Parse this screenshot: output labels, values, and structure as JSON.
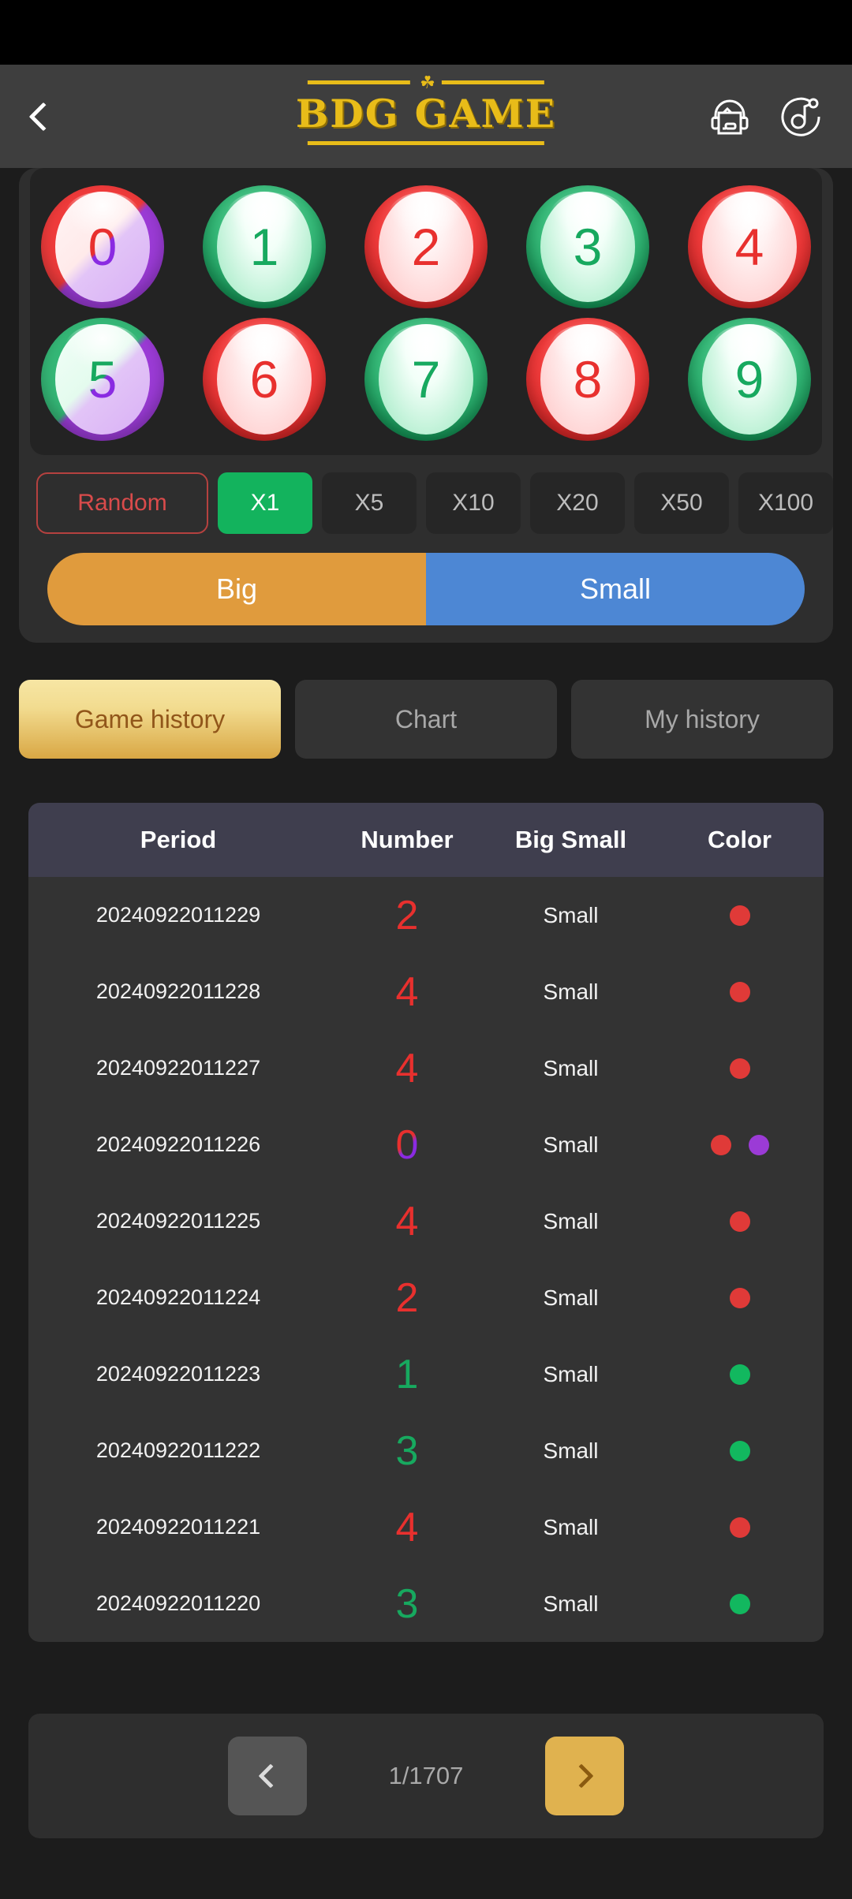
{
  "header": {
    "back_icon": "chevron-left-icon",
    "title": "BDG GAME",
    "ornament": "☘",
    "support_icon": "headset-icon",
    "sound_icon": "music-note-icon"
  },
  "bet_panel": {
    "balls": [
      {
        "number": "0",
        "style": "ball-redviolet",
        "num_class": "num-split-rv"
      },
      {
        "number": "1",
        "style": "ball-green",
        "num_class": "num-green"
      },
      {
        "number": "2",
        "style": "ball-red",
        "num_class": "num-red"
      },
      {
        "number": "3",
        "style": "ball-green",
        "num_class": "num-green"
      },
      {
        "number": "4",
        "style": "ball-red",
        "num_class": "num-red"
      },
      {
        "number": "5",
        "style": "ball-greenviolet",
        "num_class": "num-split-gv"
      },
      {
        "number": "6",
        "style": "ball-red",
        "num_class": "num-red"
      },
      {
        "number": "7",
        "style": "ball-green",
        "num_class": "num-green"
      },
      {
        "number": "8",
        "style": "ball-red",
        "num_class": "num-red"
      },
      {
        "number": "9",
        "style": "ball-green",
        "num_class": "num-green"
      }
    ],
    "multipliers": [
      {
        "label": "Random",
        "active": false
      },
      {
        "label": "X1",
        "active": true
      },
      {
        "label": "X5",
        "active": false
      },
      {
        "label": "X10",
        "active": false
      },
      {
        "label": "X20",
        "active": false
      },
      {
        "label": "X50",
        "active": false
      },
      {
        "label": "X100",
        "active": false
      }
    ],
    "big_label": "Big",
    "small_label": "Small",
    "big_color": "#e09b3d",
    "small_color": "#4d87d4",
    "active_multiplier_color": "#13b35d"
  },
  "tabs": [
    {
      "label": "Game history",
      "active": true
    },
    {
      "label": "Chart",
      "active": false
    },
    {
      "label": "My history",
      "active": false
    }
  ],
  "history_table": {
    "columns": [
      "Period",
      "Number",
      "Big Small",
      "Color"
    ],
    "rows": [
      {
        "period": "20240922011229",
        "number": "2",
        "number_class": "num-red",
        "big_small": "Small",
        "colors": [
          "dot-red"
        ]
      },
      {
        "period": "20240922011228",
        "number": "4",
        "number_class": "num-red",
        "big_small": "Small",
        "colors": [
          "dot-red"
        ]
      },
      {
        "period": "20240922011227",
        "number": "4",
        "number_class": "num-red",
        "big_small": "Small",
        "colors": [
          "dot-red"
        ]
      },
      {
        "period": "20240922011226",
        "number": "0",
        "number_class": "num-split-rv",
        "big_small": "Small",
        "colors": [
          "dot-red",
          "dot-violet"
        ]
      },
      {
        "period": "20240922011225",
        "number": "4",
        "number_class": "num-red",
        "big_small": "Small",
        "colors": [
          "dot-red"
        ]
      },
      {
        "period": "20240922011224",
        "number": "2",
        "number_class": "num-red",
        "big_small": "Small",
        "colors": [
          "dot-red"
        ]
      },
      {
        "period": "20240922011223",
        "number": "1",
        "number_class": "num-green",
        "big_small": "Small",
        "colors": [
          "dot-green"
        ]
      },
      {
        "period": "20240922011222",
        "number": "3",
        "number_class": "num-green",
        "big_small": "Small",
        "colors": [
          "dot-green"
        ]
      },
      {
        "period": "20240922011221",
        "number": "4",
        "number_class": "num-red",
        "big_small": "Small",
        "colors": [
          "dot-red"
        ]
      },
      {
        "period": "20240922011220",
        "number": "3",
        "number_class": "num-green",
        "big_small": "Small",
        "colors": [
          "dot-green"
        ]
      }
    ]
  },
  "pagination": {
    "prev_icon": "chevron-left-icon",
    "next_icon": "chevron-right-icon",
    "page_label": "1/1707"
  },
  "colors": {
    "page_bg": "#1c1c1c",
    "appbar_bg": "#3e3e3e",
    "brand_gold": "#e8bc19",
    "panel_bg": "#2e2e2e",
    "table_header_bg": "#3f3e4e",
    "red": "#e03a38",
    "green": "#12b85f",
    "violet": "#9b3bd6"
  }
}
